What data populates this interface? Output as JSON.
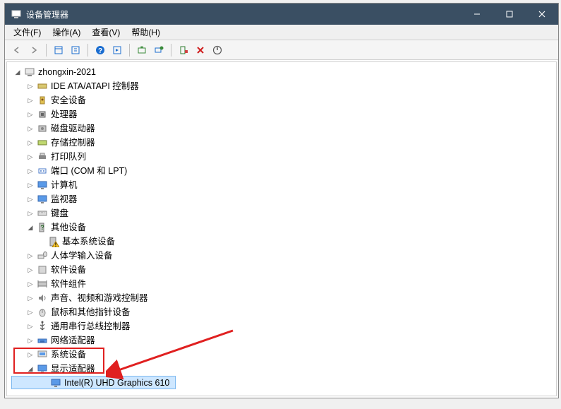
{
  "window": {
    "title": "设备管理器"
  },
  "menu": {
    "file": "文件(F)",
    "action": "操作(A)",
    "view": "查看(V)",
    "help": "帮助(H)"
  },
  "tree": {
    "root": "zhongxin-2021",
    "nodes": {
      "ide": "IDE ATA/ATAPI 控制器",
      "security": "安全设备",
      "cpu": "处理器",
      "disk": "磁盘驱动器",
      "storage": "存储控制器",
      "printq": "打印队列",
      "ports": "端口 (COM 和 LPT)",
      "computer": "计算机",
      "monitor": "监视器",
      "keyboard": "键盘",
      "other": "其他设备",
      "other_basic": "基本系统设备",
      "hid": "人体学输入设备",
      "softdev": "软件设备",
      "softcomp": "软件组件",
      "sound": "声音、视频和游戏控制器",
      "mouse": "鼠标和其他指针设备",
      "usb": "通用串行总线控制器",
      "network": "网络适配器",
      "system": "系统设备",
      "display": "显示适配器",
      "display_intel": "Intel(R) UHD Graphics 610"
    }
  }
}
